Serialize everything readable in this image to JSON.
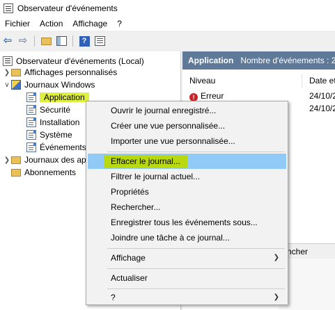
{
  "window": {
    "title": "Observateur d'événements"
  },
  "menubar": [
    "Fichier",
    "Action",
    "Affichage",
    "?"
  ],
  "toolbar": {
    "icons": [
      "back-arrow-icon",
      "forward-arrow-icon",
      "folder-up-icon",
      "show-hide-tree-icon",
      "help-icon",
      "properties-icon"
    ]
  },
  "tree": {
    "root": "Observateur d'événements (Local)",
    "custom_views": "Affichages personnalisés",
    "windows_logs": "Journaux Windows",
    "application": "Application",
    "security": "Sécurité",
    "setup": "Installation",
    "system": "Système",
    "forwarded": "Événements",
    "apps_services": "Journaux des ap",
    "subscriptions": "Abonnements"
  },
  "right_pane": {
    "header_title": "Application",
    "header_count": "Nombre d'événements : 2",
    "col_level": "Niveau",
    "col_date": "Date et",
    "rows": [
      {
        "level": "Erreur",
        "date": "24/10/2"
      },
      {
        "level": "",
        "date": "24/10/2"
      }
    ],
    "lower_label": "ncher"
  },
  "context_menu": {
    "items": [
      "Ouvrir le journal enregistré...",
      "Créer une vue personnalisée...",
      "Importer une vue personnalisée...",
      "Effacer le journal...",
      "Filtrer le journal actuel...",
      "Propriétés",
      "Rechercher...",
      "Enregistrer tous les événements sous...",
      "Joindre une tâche à ce journal...",
      "Affichage",
      "Actualiser",
      "?"
    ],
    "selected": "Effacer le journal..."
  }
}
